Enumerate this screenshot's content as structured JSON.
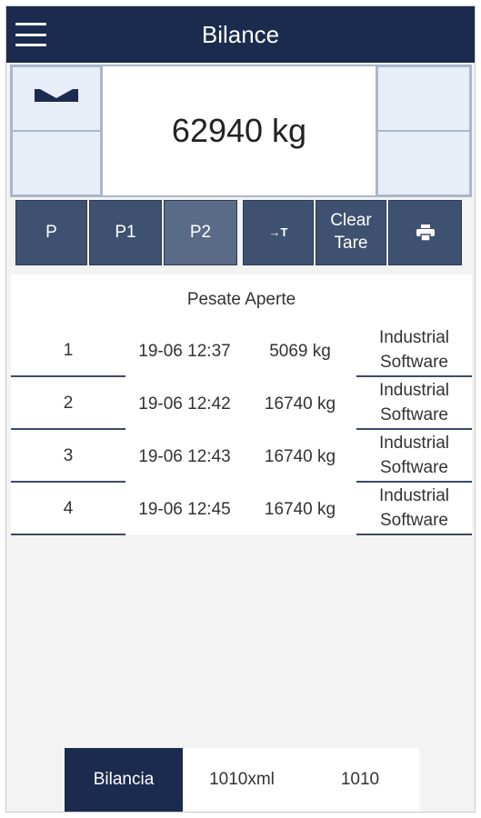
{
  "appbar": {
    "title": "Bilance",
    "menu_icon": "hamburger-menu-icon"
  },
  "scale": {
    "weight_display": "62940 kg",
    "tray_icon": "scale-tray-icon"
  },
  "toolbar": {
    "buttons": [
      {
        "label": "P"
      },
      {
        "label": "P1"
      },
      {
        "label": "P2"
      },
      {
        "label": "→T",
        "icon": "tare-arrow-icon"
      },
      {
        "label": "Clear Tare"
      },
      {
        "label": "🖶",
        "icon": "printer-icon"
      }
    ]
  },
  "weighings": {
    "title": "Pesate Aperte",
    "rows": [
      {
        "num": "1",
        "date": "19-06 12:37",
        "weight": "5069 kg",
        "operator": "Industrial Software"
      },
      {
        "num": "2",
        "date": "19-06 12:42",
        "weight": "16740 kg",
        "operator": "Industrial Software"
      },
      {
        "num": "3",
        "date": "19-06 12:43",
        "weight": "16740 kg",
        "operator": "Industrial Software"
      },
      {
        "num": "4",
        "date": "19-06 12:45",
        "weight": "16740 kg",
        "operator": "Industrial Software"
      }
    ]
  },
  "bottom_tabs": [
    {
      "label": "Bilancia"
    },
    {
      "label": "1010xml"
    },
    {
      "label": "1010"
    }
  ],
  "colors": {
    "primary": "#1b2b4e",
    "button": "#3f5170",
    "button_active": "#5a6b88"
  }
}
